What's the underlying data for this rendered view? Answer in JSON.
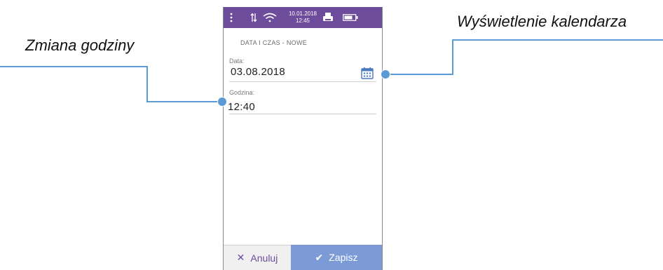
{
  "annotations": {
    "left": "Zmiana godziny",
    "right": "Wyświetlenie kalendarza"
  },
  "statusbar": {
    "date": "10.01.2018",
    "time": "12:45",
    "icons": [
      "menu-dots-icon",
      "data-transfer-icon",
      "wifi-icon",
      "printer-icon",
      "battery-icon"
    ]
  },
  "screen": {
    "title": "DATA I CZAS - NOWE",
    "date": {
      "label": "Data:",
      "value": "03.08.2018"
    },
    "time": {
      "label": "Godzina:",
      "value": "12:40"
    }
  },
  "footer": {
    "cancel_label": "Anuluj",
    "save_label": "Zapisz"
  },
  "colors": {
    "statusbar": "#6d4c9b",
    "save_button": "#7c9bd6",
    "callout": "#5b9bd5"
  }
}
